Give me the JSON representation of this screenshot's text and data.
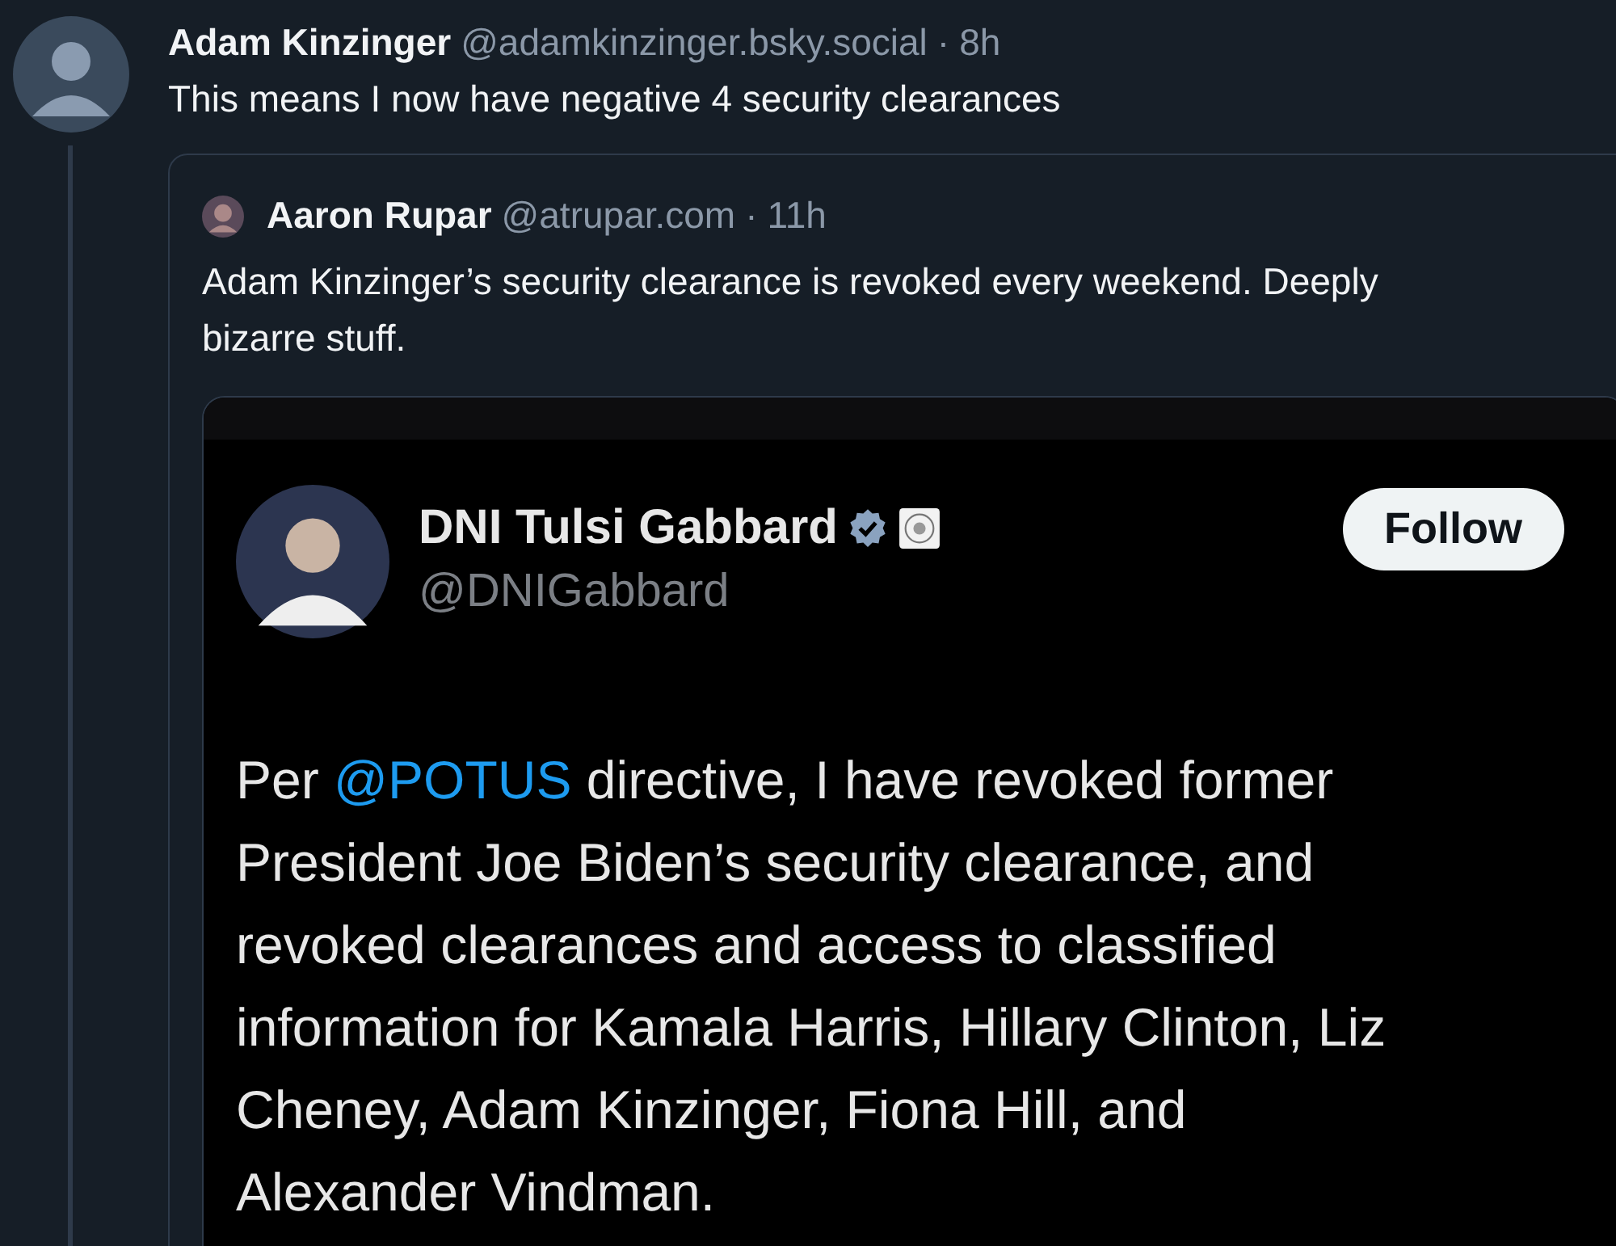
{
  "post": {
    "name": "Adam Kinzinger",
    "handle": "@adamkinzinger.bsky.social",
    "separator": "·",
    "time": "8h",
    "text": "This means I now have negative 4 security clearances"
  },
  "quote": {
    "name": "Aaron Rupar",
    "handle": "@atrupar.com",
    "separator": "·",
    "time": "11h",
    "text": "Adam Kinzinger’s security clearance is revoked every weekend. Deeply bizarre stuff."
  },
  "embedded_screenshot": {
    "name": "DNI Tulsi Gabbard",
    "verified": true,
    "handle": "@DNIGabbard",
    "follow_button": "Follow",
    "body": [
      {
        "kind": "text",
        "text": "Per "
      },
      {
        "kind": "mention",
        "text": "@POTUS"
      },
      {
        "kind": "text",
        "text": " directive, I have revoked former President Joe Biden’s security clearance, and revoked clearances and access to classified information for Kamala Harris, Hillary Clinton, Liz Cheney, Adam Kinzinger, Fiona Hill, and Alexander Vindman."
      }
    ]
  }
}
